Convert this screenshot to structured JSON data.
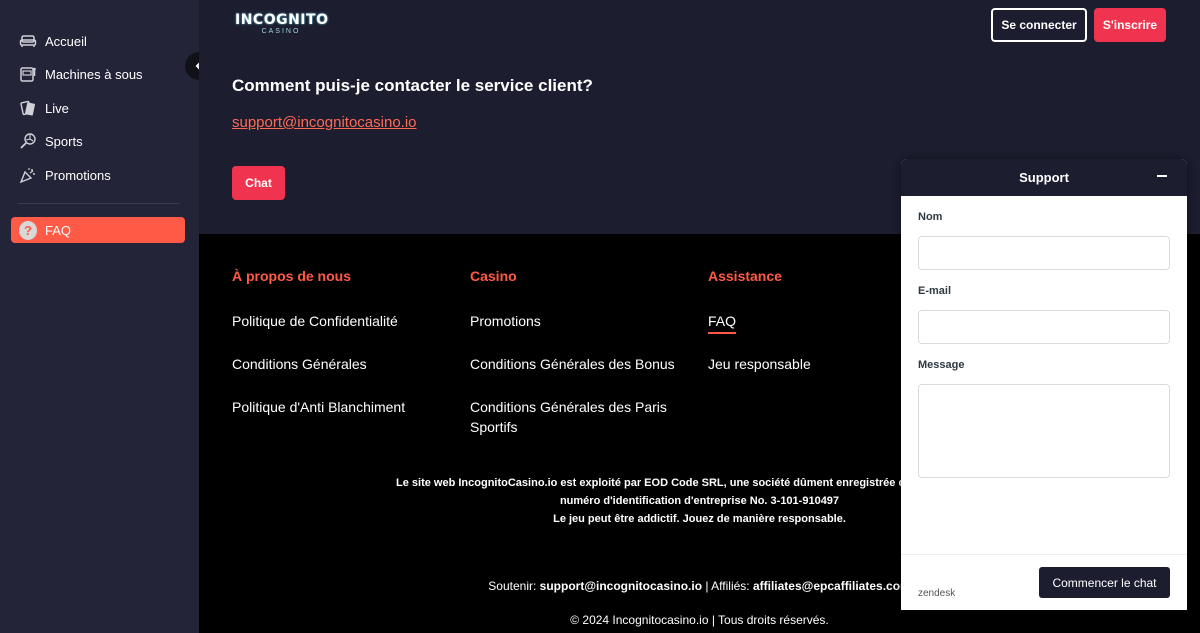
{
  "sidebar": {
    "items": [
      {
        "label": "Accueil",
        "icon": "sofa-icon"
      },
      {
        "label": "Machines à sous",
        "icon": "slot-machine-icon"
      },
      {
        "label": "Live",
        "icon": "cards-icon"
      },
      {
        "label": "Sports",
        "icon": "sports-ball-icon"
      },
      {
        "label": "Promotions",
        "icon": "party-popper-icon"
      }
    ],
    "faq": {
      "label": "FAQ",
      "icon_glyph": "?"
    }
  },
  "header": {
    "logo_main": "INCOGNITO",
    "logo_sub": "CASINO",
    "login_label": "Se connecter",
    "signup_label": "S'inscrire"
  },
  "faq": {
    "question": "Comment puis-je contacter le service client?",
    "email": "support@incognitocasino.io",
    "chat_label": "Chat"
  },
  "footer": {
    "columns": [
      {
        "heading": "À propos de nous",
        "links": [
          "Politique de Confidentialité",
          "Conditions Générales",
          "Politique d'Anti Blanchiment"
        ]
      },
      {
        "heading": "Casino",
        "links": [
          "Promotions",
          "Conditions Générales des Bonus",
          "Conditions Générales des Paris Sportifs"
        ]
      },
      {
        "heading": "Assistance",
        "links": [
          "FAQ",
          "Jeu responsable"
        ]
      }
    ],
    "legal_line1": "Le site web IncognitoCasino.io est exploité par EOD Code SRL, une société dûment enregistrée conformément aux l",
    "legal_line2": "numéro d'identification d'entreprise No. 3-101-910497",
    "legal_line3": "Le jeu peut être addictif. Jouez de manière responsable.",
    "support_prefix": "Soutenir: ",
    "support_email": "support@incognitocasino.io",
    "affiliates_prefix": " | Affiliés: ",
    "affiliates_email": "affiliates@epcaffiliates.com",
    "copyright": "© 2024 Incognitocasino.io | Tous droits réservés."
  },
  "widget": {
    "title": "Support",
    "name_label": "Nom",
    "email_label": "E-mail",
    "message_label": "Message",
    "brand": "zendesk",
    "start_label": "Commencer le chat"
  },
  "colors": {
    "accent": "#ff5a45",
    "button_red": "#f0344f",
    "bg_dark": "#1c1d2f",
    "sidebar": "#232438"
  }
}
